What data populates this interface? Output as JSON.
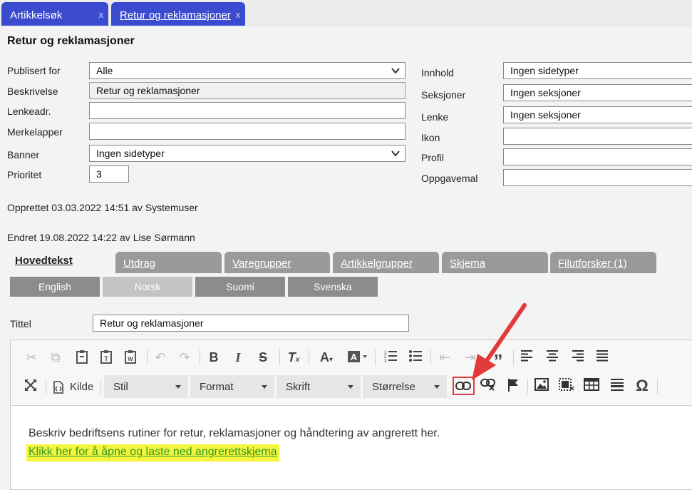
{
  "tabs": [
    {
      "label": "Artikkelsøk",
      "close": "x"
    },
    {
      "label": "Retur og reklamasjoner",
      "close": "x"
    }
  ],
  "page_title": "Retur og reklamasjoner",
  "form_left": {
    "publisert_for": {
      "label": "Publisert for",
      "value": "Alle"
    },
    "beskrivelse": {
      "label": "Beskrivelse",
      "value": "Retur og reklamasjoner"
    },
    "lenkeadr": {
      "label": "Lenkeadr.",
      "value": ""
    },
    "merkelapper": {
      "label": "Merkelapper",
      "value": ""
    },
    "banner": {
      "label": "Banner",
      "value": "Ingen sidetyper"
    },
    "prioritet": {
      "label": "Prioritet",
      "value": "3"
    }
  },
  "form_right": {
    "innhold": {
      "label": "Innhold",
      "value": "Ingen sidetyper"
    },
    "seksjoner": {
      "label": "Seksjoner",
      "value": "Ingen seksjoner"
    },
    "lenke": {
      "label": "Lenke",
      "value": "Ingen seksjoner"
    },
    "ikon": {
      "label": "Ikon",
      "value": ""
    },
    "profil": {
      "label": "Profil",
      "value": ""
    },
    "oppgavemal": {
      "label": "Oppgavemal",
      "value": ""
    }
  },
  "meta": {
    "created": "Opprettet 03.03.2022 14:51 av Systemuser",
    "changed": "Endret 19.08.2022 14:22 av Lise Sørmann"
  },
  "subtabs": [
    "Hovedtekst",
    "Utdrag",
    "Varegrupper",
    "Artikkelgrupper",
    "Skjema",
    "Filutforsker (1)"
  ],
  "languages": [
    "English",
    "Norsk",
    "Suomi",
    "Svenska"
  ],
  "tittel": {
    "label": "Tittel",
    "value": "Retur og reklamasjoner"
  },
  "toolbar": {
    "kilde_label": "Kilde",
    "combos": [
      "Stil",
      "Format",
      "Skrift",
      "Størrelse"
    ]
  },
  "content": {
    "text": "Beskriv bedriftsens rutiner for retur, reklamasjoner og håndtering av angrerett her.",
    "link": "Klikk her for å åpne og laste ned angrerettskjema"
  },
  "colors": {
    "tab_blue": "#3a4bd0",
    "subtab_gray": "#9a9a9a",
    "highlight_yellow": "#f5f53c",
    "link_green": "#2a9a2a",
    "annotation_red": "#e23a3a"
  }
}
